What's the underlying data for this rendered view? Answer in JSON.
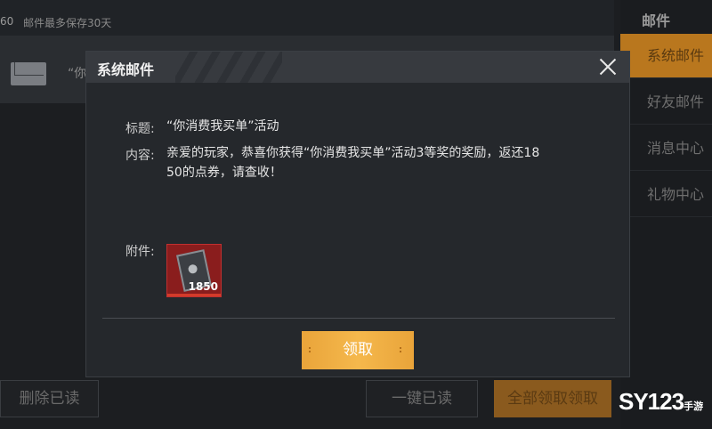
{
  "background": {
    "count_text": "60",
    "note": "邮件最多保存30天",
    "mail_snippet": "“你"
  },
  "sidebar": {
    "header": "邮件",
    "items": [
      {
        "label": "系统邮件",
        "active": true
      },
      {
        "label": "好友邮件",
        "active": false
      },
      {
        "label": "消息中心",
        "active": false
      },
      {
        "label": "礼物中心",
        "active": false
      }
    ]
  },
  "bottom_buttons": {
    "delete_read": "删除已读",
    "one_click_read": "一键已读",
    "claim_all": "全部领取领取"
  },
  "watermark": {
    "text": "SY123",
    "sub": "手游"
  },
  "modal": {
    "title": "系统邮件",
    "subject_label": "标题:",
    "subject_value": "“你消费我买单”活动",
    "content_label": "内容:",
    "content_line1": "亲爱的玩家，恭喜你获得“你消费我买单”活动3等奖的奖励，返还18",
    "content_line2": "50的点券，请查收！",
    "attachment_label": "附件:",
    "attachment": {
      "count": "1850",
      "icon": "coupon-icon"
    },
    "claim_button": "领取"
  },
  "colors": {
    "accent_gold": "#b9771e",
    "claim_button": "#f0ad42",
    "item_frame": "#8a1d1d"
  }
}
